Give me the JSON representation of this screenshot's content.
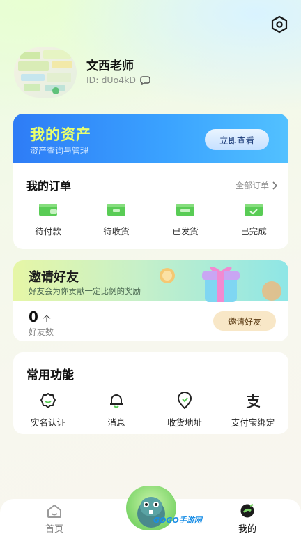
{
  "profile": {
    "nickname": "文西老师",
    "uid": "ID: dUo4kD"
  },
  "assets": {
    "title": "我的资产",
    "subtitle": "资产查询与管理",
    "button_label": "立即查看"
  },
  "orders": {
    "title": "我的订单",
    "all_label": "全部订单",
    "items": [
      {
        "label": "待付款",
        "icon": "wallet-icon",
        "color": "#59cc55"
      },
      {
        "label": "待收货",
        "icon": "receive-icon",
        "color": "#59cc55"
      },
      {
        "label": "已发货",
        "icon": "shipped-icon",
        "color": "#59cc55"
      },
      {
        "label": "已完成",
        "icon": "completed-icon",
        "color": "#59cc55"
      }
    ]
  },
  "invite": {
    "title": "邀请好友",
    "subtitle": "好友会为你贡献一定比例的奖励",
    "count": "0",
    "unit": "个",
    "count_label": "好友数",
    "button_label": "邀请好友"
  },
  "functions": {
    "title": "常用功能",
    "items": [
      {
        "label": "实名认证",
        "icon": "verify-icon"
      },
      {
        "label": "消息",
        "icon": "bell-icon"
      },
      {
        "label": "收货地址",
        "icon": "location-icon"
      },
      {
        "label": "支付宝绑定",
        "icon": "alipay-icon"
      }
    ]
  },
  "tabbar": {
    "home_label": "首页",
    "mine_label": "我的"
  },
  "watermark": "GOGO手游网",
  "colors": {
    "accent_green": "#59cc55",
    "assets_blue": "#2e7cf6",
    "assets_title": "#e9ff6e"
  }
}
